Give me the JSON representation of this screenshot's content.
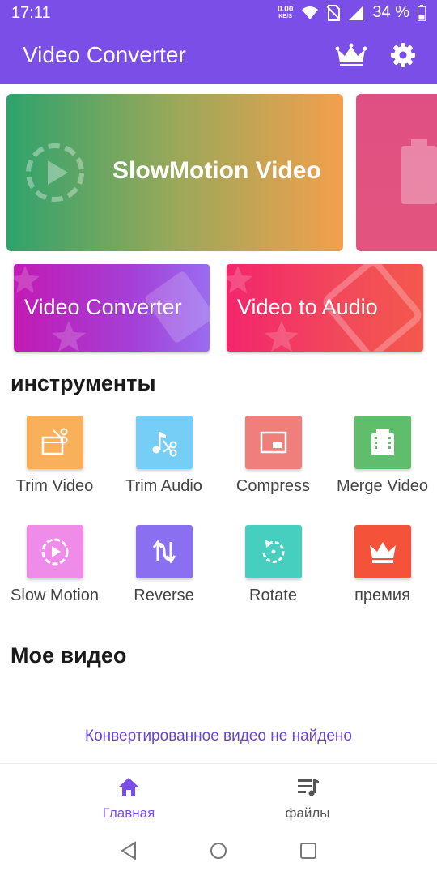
{
  "status": {
    "time": "17:11",
    "net_speed": "0.00",
    "net_unit": "KB/S",
    "battery": "34 %"
  },
  "app_bar": {
    "title": "Video Converter",
    "icons": [
      "crown-icon",
      "gear-icon"
    ]
  },
  "banners": [
    {
      "title": "SlowMotion Video",
      "icon": "slow-motion-play-icon"
    },
    {
      "title": "",
      "icon": "film-strip-icon"
    }
  ],
  "cards": [
    {
      "label": "Video Converter"
    },
    {
      "label": "Video to Audio"
    }
  ],
  "tools": {
    "title": "инструменты",
    "items": [
      {
        "label": "Trim Video",
        "icon": "trim-video-icon",
        "color": "#f9b05a"
      },
      {
        "label": "Trim Audio",
        "icon": "trim-audio-icon",
        "color": "#76cdf5"
      },
      {
        "label": "Compress",
        "icon": "compress-icon",
        "color": "#f07e7b"
      },
      {
        "label": "Merge Video",
        "icon": "merge-video-icon",
        "color": "#5fbd6b"
      },
      {
        "label": "Slow Motion",
        "icon": "slow-motion-icon",
        "color": "#ef8be8"
      },
      {
        "label": "Reverse",
        "icon": "reverse-icon",
        "color": "#8b6ff1"
      },
      {
        "label": "Rotate",
        "icon": "rotate-icon",
        "color": "#46cfbe"
      },
      {
        "label": "премия",
        "icon": "crown-icon",
        "color": "#f4533a"
      }
    ]
  },
  "my_video": {
    "title": "Мое видео",
    "empty_message": "Конвертированное видео не найдено"
  },
  "bottom_nav": [
    {
      "label": "Главная",
      "icon": "home-icon",
      "active": true
    },
    {
      "label": "файлы",
      "icon": "files-icon",
      "active": false
    }
  ],
  "colors": {
    "primary": "#7b4ee8",
    "accent_text": "#6a44c9"
  }
}
